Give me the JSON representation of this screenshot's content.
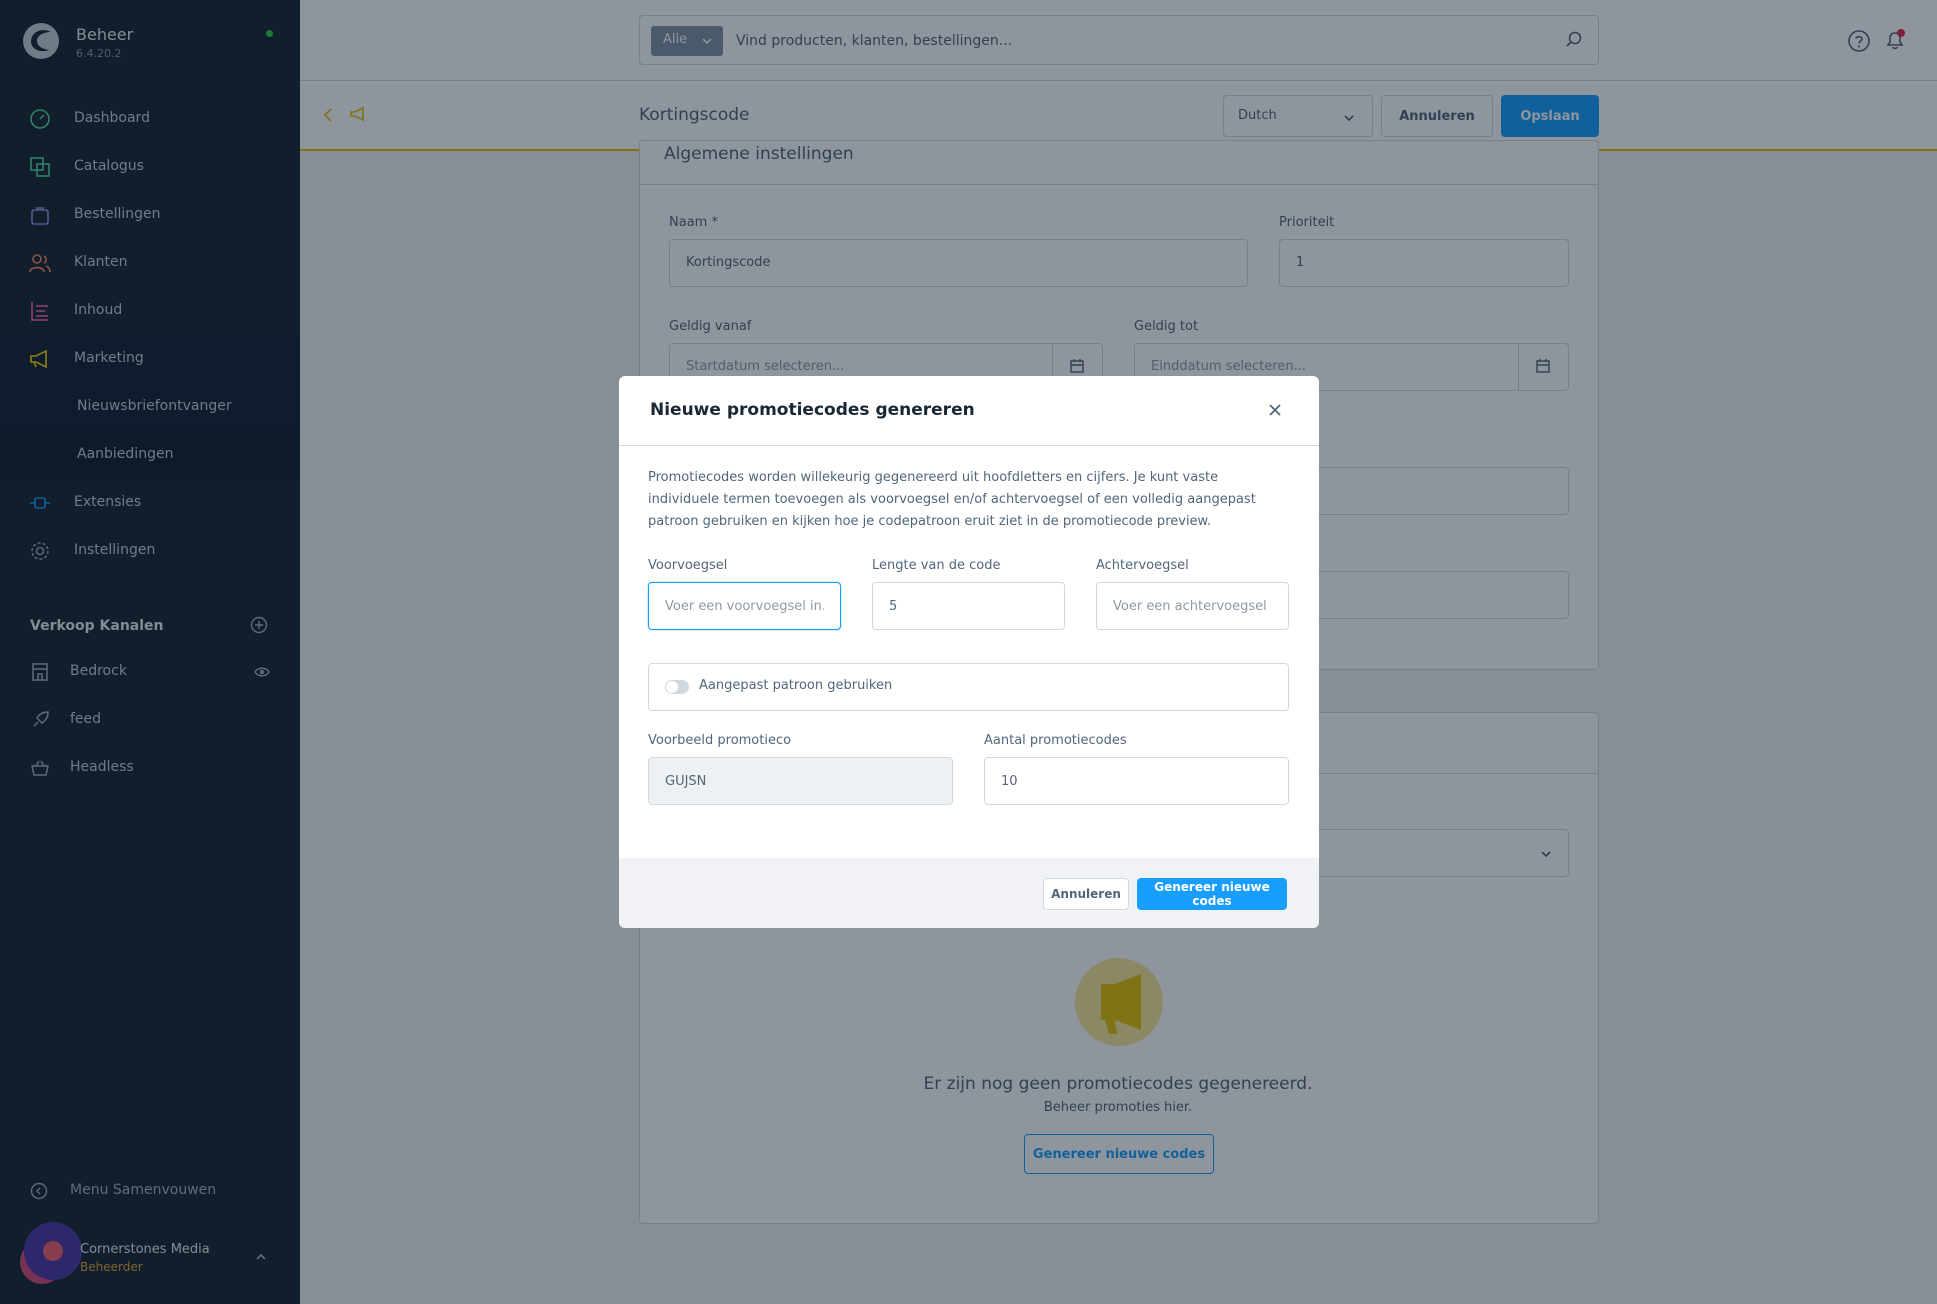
{
  "brand": {
    "title": "Beheer",
    "version": "6.4.20.2"
  },
  "sidebar": {
    "items": [
      {
        "label": "Dashboard",
        "icon": "gauge-icon",
        "color": "#57d9a3"
      },
      {
        "label": "Catalogus",
        "icon": "catalog-icon",
        "color": "#57d9a3"
      },
      {
        "label": "Bestellingen",
        "icon": "shopping-bag-icon",
        "color": "#a092f0"
      },
      {
        "label": "Klanten",
        "icon": "users-icon",
        "color": "#f88962"
      },
      {
        "label": "Inhoud",
        "icon": "content-icon",
        "color": "#ff68b4"
      },
      {
        "label": "Marketing",
        "icon": "megaphone-icon",
        "color": "#ffd700"
      },
      {
        "label": "Nieuwsbriefontvanger"
      },
      {
        "label": "Aanbiedingen"
      },
      {
        "label": "Extensies",
        "icon": "plug-icon",
        "color": "#189eff"
      },
      {
        "label": "Instellingen",
        "icon": "gear-icon",
        "color": "#9aa8b5"
      }
    ],
    "sales_channels_label": "Verkoop Kanalen",
    "sales_channels": [
      {
        "label": "Bedrock",
        "icon": "storefront-icon"
      },
      {
        "label": "feed",
        "icon": "rocket-icon"
      },
      {
        "label": "Headless",
        "icon": "basket-icon"
      }
    ],
    "collapse_label": "Menu Samenvouwen",
    "user": {
      "name": "Cornerstones Media",
      "role": "Beheerder"
    }
  },
  "topbar": {
    "search_filter": "Alle",
    "search_placeholder": "Vind producten, klanten, bestellingen..."
  },
  "smartbar": {
    "title": "Kortingscode",
    "language": "Dutch",
    "cancel_label": "Annuleren",
    "save_label": "Opslaan"
  },
  "settings_card": {
    "title": "Algemene instellingen",
    "name_label": "Naam *",
    "name_value": "Kortingscode",
    "priority_label": "Prioriteit",
    "priority_value": "1",
    "valid_from_label": "Geldig vanaf",
    "valid_from_placeholder": "Startdatum selecteren...",
    "valid_until_label": "Geldig tot",
    "valid_until_placeholder": "Einddatum selecteren..."
  },
  "empty_state": {
    "title": "Er zijn nog geen promotiecodes gegenereerd.",
    "subtitle": "Beheer promoties hier.",
    "button_label": "Genereer nieuwe codes"
  },
  "modal": {
    "title": "Nieuwe promotiecodes genereren",
    "description": "Promotiecodes worden willekeurig gegenereerd uit hoofdletters en cijfers. Je kunt vaste individuele termen toevoegen als voorvoegsel en/of achtervoegsel of een volledig aangepast patroon gebruiken en kijken hoe je codepatroon eruit ziet in de promotiecode preview.",
    "prefix_label": "Voorvoegsel",
    "prefix_placeholder": "Voer een voorvoegsel in...",
    "length_label": "Lengte van de code",
    "length_value": "5",
    "suffix_label": "Achtervoegsel",
    "suffix_placeholder": "Voer een achtervoegsel in...",
    "custom_pattern_label": "Aangepast patroon gebruiken",
    "preview_label": "Voorbeeld promotieco",
    "preview_value": "GUJSN",
    "count_label": "Aantal promotiecodes",
    "count_value": "10",
    "cancel_label": "Annuleren",
    "generate_label": "Genereer nieuwe codes"
  },
  "colors": {
    "sidebar_bg": "#1a2836",
    "accent": "#189eff",
    "smartbar_border": "#e3c20b"
  }
}
